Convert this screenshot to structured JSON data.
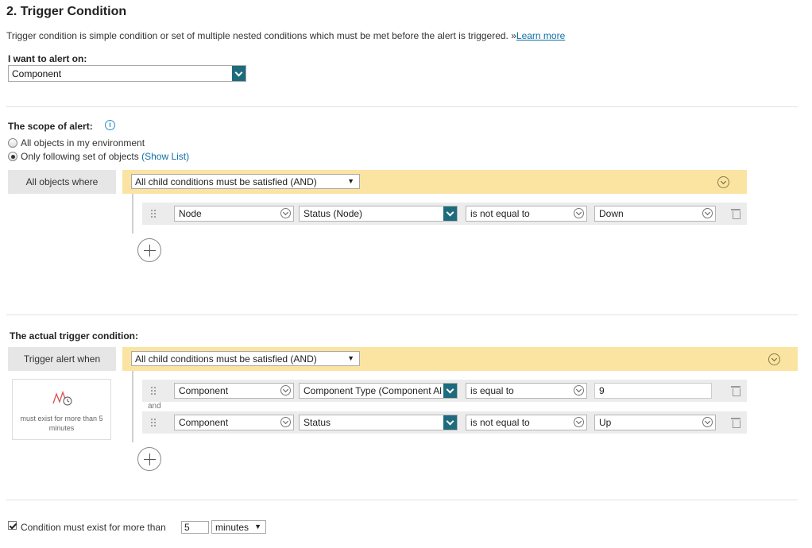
{
  "section": {
    "title": "2. Trigger Condition",
    "description": "Trigger condition is simple condition or set of multiple nested conditions which must be met before the alert is triggered. »",
    "learn_more": "Learn more"
  },
  "alert_on": {
    "label": "I want to alert on:",
    "value": "Component"
  },
  "scope": {
    "label": "The scope of alert:",
    "option_all": "All objects in my environment",
    "option_following": "Only following set of objects",
    "show_list": "(Show List)",
    "selected": "Only following set of objects",
    "tab_label": "All objects where",
    "group_operator": "All child conditions must be satisfied (AND)",
    "conditions": [
      {
        "object": "Node",
        "field": "Status (Node)",
        "operator": "is not equal to",
        "value": "Down"
      }
    ]
  },
  "trigger": {
    "label": "The actual trigger condition:",
    "tab_label": "Trigger alert when",
    "group_operator": "All child conditions must be satisfied (AND)",
    "join_word": "and",
    "card_text": "must exist for more than 5 minutes",
    "conditions": [
      {
        "object": "Component",
        "field": "Component Type (Component Al",
        "operator": "is equal to",
        "value": "9"
      },
      {
        "object": "Component",
        "field": "Status",
        "operator": "is not equal to",
        "value": "Up"
      }
    ]
  },
  "duration": {
    "checked": true,
    "label": "Condition must exist for more than",
    "value": "5",
    "unit": "minutes"
  },
  "colors": {
    "accent_teal": "#1e6b7d",
    "group_bar": "#fbe4a2",
    "link": "#0f6fa5"
  },
  "icons": {
    "info": "info-icon",
    "drag": "drag-handle-icon",
    "delete": "trash-icon",
    "add": "plus-circle-icon",
    "expand": "chevron-down-circle-icon",
    "time": "time-condition-icon"
  }
}
